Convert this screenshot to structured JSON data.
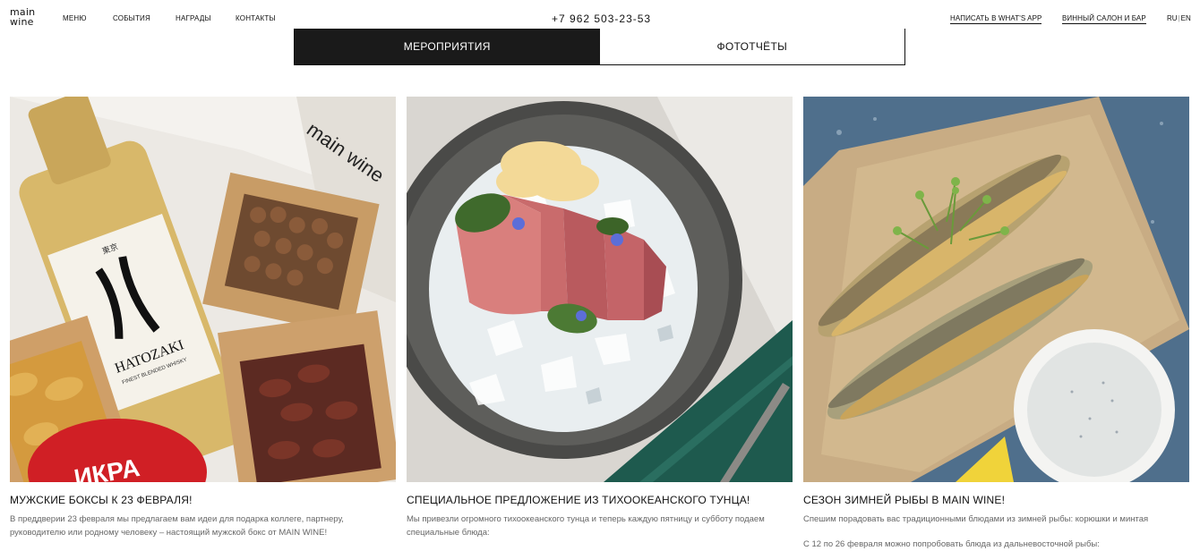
{
  "header": {
    "logo_line1": "main",
    "logo_line2": "wine",
    "nav": [
      "меню",
      "события",
      "награды",
      "контакты"
    ],
    "phone": "+7 962 503-23-53",
    "whatsapp_link": "Написать в What's App",
    "salon_link": "Винный салон и бар",
    "lang_ru": "RU",
    "lang_sep": "|",
    "lang_en": "EN"
  },
  "tabs": [
    {
      "label": "Мероприятия",
      "active": true
    },
    {
      "label": "Фототчёты",
      "active": false
    }
  ],
  "cards": [
    {
      "title": "Мужские боксы к 23 февраля!",
      "text": "В преддверии 23 февраля мы предлагаем вам идеи для подарка коллеге, партнеру, руководителю или родному человеку – настоящий мужской бокс от MAIN WINE!",
      "text2": "",
      "photo": {
        "bottle_label": "HATOZAKI",
        "bottle_sublabel": "FINEST BLENDED WHISKY",
        "tin_label": "ИКРА",
        "paper_print": "main wine"
      }
    },
    {
      "title": "Специальное предложение из тихоокеанского тунца!",
      "text": "Мы привезли огромного тихоокеанского тунца и теперь каждую пятницу и субботу подаем специальные блюда:",
      "text2": "",
      "photo": {}
    },
    {
      "title": "Сезон зимней рыбы в MAIN WINE!",
      "text": "Спешим порадовать вас традиционными блюдами из зимней рыбы: корюшки и минтая",
      "text2": "С 12 по 26 февраля можно попробовать блюда из дальневосточной рыбы:",
      "photo": {}
    }
  ],
  "colors": {
    "active_tab_bg": "#1a1a1a",
    "text_muted": "#666666"
  }
}
